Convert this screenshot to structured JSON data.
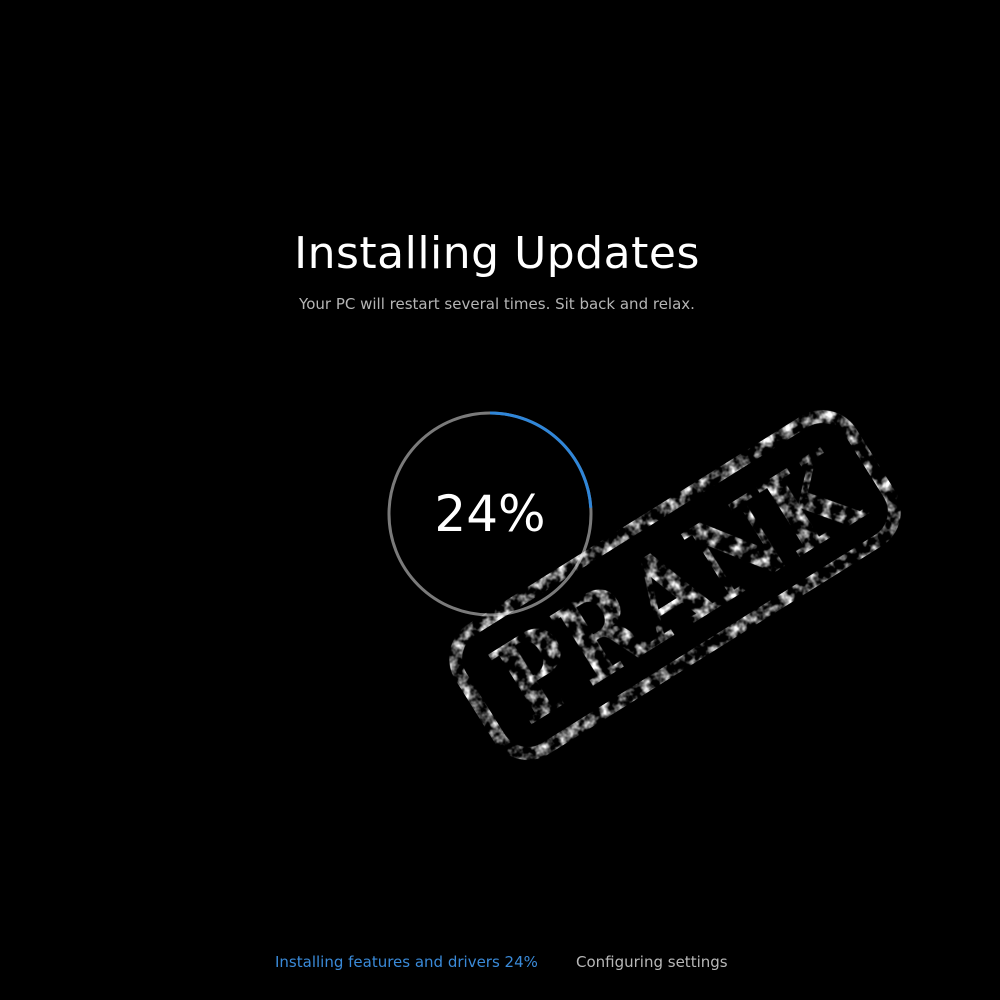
{
  "screen": {
    "title": "Installing Updates",
    "subtitle": "Your PC will restart several times. Sit back and relax."
  },
  "progress": {
    "label": "24%",
    "value_percent": 24,
    "track_color": "#7a7a7a",
    "fill_color": "#2f86d9"
  },
  "stamp": {
    "text": "PRANK",
    "color": "#ffffff"
  },
  "steps": {
    "active": "Installing features and drivers 24%",
    "next": "Configuring settings",
    "active_color": "#3a8ad8"
  }
}
